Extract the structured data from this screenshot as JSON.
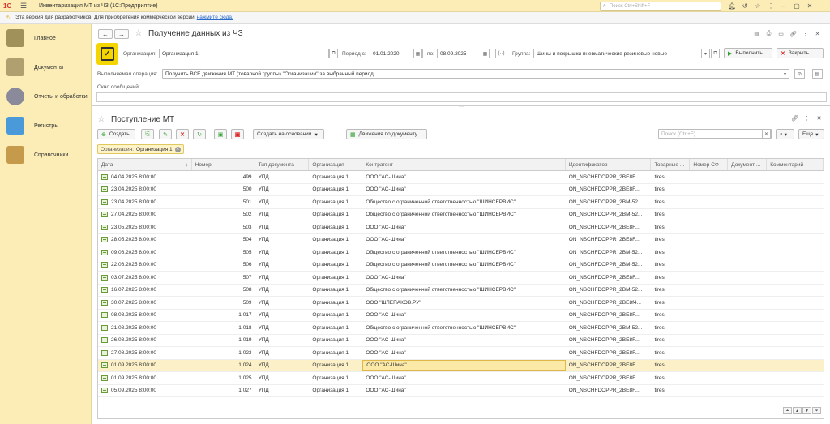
{
  "titlebar": {
    "logo": "1С",
    "title": "Инвентаризация МТ из ЧЗ  (1С:Предприятие)",
    "search_placeholder": "Поиск Ctrl+Shift+F"
  },
  "devbar": {
    "text": "Эта версия для разработчиков. Для приобретения коммерческой версии",
    "link": "нажмите сюда."
  },
  "sidebar": {
    "items": [
      {
        "label": "Главное",
        "color": "#8a7a3a"
      },
      {
        "label": "Документы",
        "color": "#9a8a5a"
      },
      {
        "label": "Отчеты и обработки",
        "color": "#7a7a8a"
      },
      {
        "label": "Регистры",
        "color": "#3a8ac9"
      },
      {
        "label": "Справочники",
        "color": "#b58a3a"
      }
    ]
  },
  "form1": {
    "title": "Получение данных из ЧЗ",
    "org_label": "Организация:",
    "org_value": "Организация 1",
    "period_label": "Период с:",
    "period_from": "01.01.2020",
    "period_to_label": "по:",
    "period_to": "08.09.2025",
    "group_label": "Группа:",
    "group_value": "Шины и покрышки пневматические резиновые новые",
    "run_label": "Выполнить",
    "close_label": "Закрыть",
    "operation_label": "Выполняемая операция:",
    "operation_value": "Получить ВСЕ движения МТ (товарной группы) \"Организации\" за выбранный период.",
    "messages_label": "Окно сообщений:"
  },
  "form2": {
    "title": "Поступление МТ",
    "create_label": "Создать",
    "create_based_label": "Создать на основании",
    "movements_label": "Движения по документу",
    "search_placeholder": "Поиск (Ctrl+F)",
    "more_label": "Еще",
    "filter_label": "Организация:",
    "filter_value": "Организация 1"
  },
  "table": {
    "headers": [
      "Дата",
      "Номер",
      "Тип документа",
      "Организация",
      "Контрагент",
      "Идентификатор",
      "Товарные ...",
      "Номер СФ",
      "Документ ...",
      "Комментарий"
    ],
    "rows": [
      {
        "date": "04.04.2025 8:00:00",
        "num": "499",
        "type": "УПД",
        "org": "Организация 1",
        "contractor": "ООО \"АС-Шина\"",
        "id": "ON_NSCHFDOPPR_2BE8F...",
        "goods": "tires"
      },
      {
        "date": "23.04.2025 8:00:00",
        "num": "500",
        "type": "УПД",
        "org": "Организация 1",
        "contractor": "ООО \"АС-Шина\"",
        "id": "ON_NSCHFDOPPR_2BE8F...",
        "goods": "tires"
      },
      {
        "date": "23.04.2025 8:00:00",
        "num": "501",
        "type": "УПД",
        "org": "Организация 1",
        "contractor": "Общество с ограниченной ответственностью \"ШИНСЕРВИС\"",
        "id": "ON_NSCHFDOPPR_2BM-52...",
        "goods": "tires"
      },
      {
        "date": "27.04.2025 8:00:00",
        "num": "502",
        "type": "УПД",
        "org": "Организация 1",
        "contractor": "Общество с ограниченной ответственностью \"ШИНСЕРВИС\"",
        "id": "ON_NSCHFDOPPR_2BM-52...",
        "goods": "tires"
      },
      {
        "date": "23.05.2025 8:00:00",
        "num": "503",
        "type": "УПД",
        "org": "Организация 1",
        "contractor": "ООО \"АС-Шина\"",
        "id": "ON_NSCHFDOPPR_2BE8F...",
        "goods": "tires"
      },
      {
        "date": "28.05.2025 8:00:00",
        "num": "504",
        "type": "УПД",
        "org": "Организация 1",
        "contractor": "ООО \"АС-Шина\"",
        "id": "ON_NSCHFDOPPR_2BE8F...",
        "goods": "tires"
      },
      {
        "date": "09.06.2025 8:00:00",
        "num": "505",
        "type": "УПД",
        "org": "Организация 1",
        "contractor": "Общество с ограниченной ответственностью \"ШИНСЕРВИС\"",
        "id": "ON_NSCHFDOPPR_2BM-52...",
        "goods": "tires"
      },
      {
        "date": "22.06.2025 8:00:00",
        "num": "506",
        "type": "УПД",
        "org": "Организация 1",
        "contractor": "Общество с ограниченной ответственностью \"ШИНСЕРВИС\"",
        "id": "ON_NSCHFDOPPR_2BM-52...",
        "goods": "tires"
      },
      {
        "date": "03.07.2025 8:00:00",
        "num": "507",
        "type": "УПД",
        "org": "Организация 1",
        "contractor": "ООО \"АС-Шина\"",
        "id": "ON_NSCHFDOPPR_2BE8F...",
        "goods": "tires"
      },
      {
        "date": "16.07.2025 8:00:00",
        "num": "508",
        "type": "УПД",
        "org": "Организация 1",
        "contractor": "Общество с ограниченной ответственностью \"ШИНСЕРВИС\"",
        "id": "ON_NSCHFDOPPR_2BM-52...",
        "goods": "tires"
      },
      {
        "date": "30.07.2025 8:00:00",
        "num": "509",
        "type": "УПД",
        "org": "Организация 1",
        "contractor": "ООО  \"ШЛЕПАКОВ.РУ\"",
        "id": "ON_NSCHFDOPPR_2BE8f4...",
        "goods": "tires"
      },
      {
        "date": "08.08.2025 8:00:00",
        "num": "1 017",
        "type": "УПД",
        "org": "Организация 1",
        "contractor": "ООО \"АС-Шина\"",
        "id": "ON_NSCHFDOPPR_2BE8F...",
        "goods": "tires"
      },
      {
        "date": "21.08.2025 8:00:00",
        "num": "1 018",
        "type": "УПД",
        "org": "Организация 1",
        "contractor": "Общество с ограниченной ответственностью \"ШИНСЕРВИС\"",
        "id": "ON_NSCHFDOPPR_2BM-52...",
        "goods": "tires"
      },
      {
        "date": "26.08.2025 8:00:00",
        "num": "1 019",
        "type": "УПД",
        "org": "Организация 1",
        "contractor": "ООО \"АС-Шина\"",
        "id": "ON_NSCHFDOPPR_2BE8F...",
        "goods": "tires"
      },
      {
        "date": "27.08.2025 8:00:00",
        "num": "1 023",
        "type": "УПД",
        "org": "Организация 1",
        "contractor": "ООО \"АС-Шина\"",
        "id": "ON_NSCHFDOPPR_2BE8F...",
        "goods": "tires"
      },
      {
        "date": "01.09.2025 8:00:00",
        "num": "1 024",
        "type": "УПД",
        "org": "Организация 1",
        "contractor": "ООО \"АС-Шина\"",
        "id": "ON_NSCHFDOPPR_2BE8F...",
        "goods": "tires",
        "selected": true
      },
      {
        "date": "01.09.2025 8:00:00",
        "num": "1 025",
        "type": "УПД",
        "org": "Организация 1",
        "contractor": "ООО \"АС-Шина\"",
        "id": "ON_NSCHFDOPPR_2BE8F...",
        "goods": "tires"
      },
      {
        "date": "05.09.2025 8:00:00",
        "num": "1 027",
        "type": "УПД",
        "org": "Организация 1",
        "contractor": "ООО \"АС-Шина\"",
        "id": "ON_NSCHFDOPPR_2BE8F...",
        "goods": "tires"
      }
    ]
  }
}
